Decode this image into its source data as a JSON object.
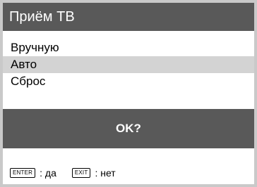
{
  "title": "Приём ТВ",
  "menu": {
    "items": [
      {
        "label": "Вручную",
        "selected": false
      },
      {
        "label": "Авто",
        "selected": true
      },
      {
        "label": "Сброс",
        "selected": false
      }
    ]
  },
  "confirm": {
    "label": "OK?"
  },
  "hints": [
    {
      "key": "ENTER",
      "text": ": да"
    },
    {
      "key": "EXIT",
      "text": ": нет"
    }
  ],
  "colors": {
    "bar": "#595959",
    "selected": "#d3d3d3",
    "frame": "#c9c9c9"
  }
}
